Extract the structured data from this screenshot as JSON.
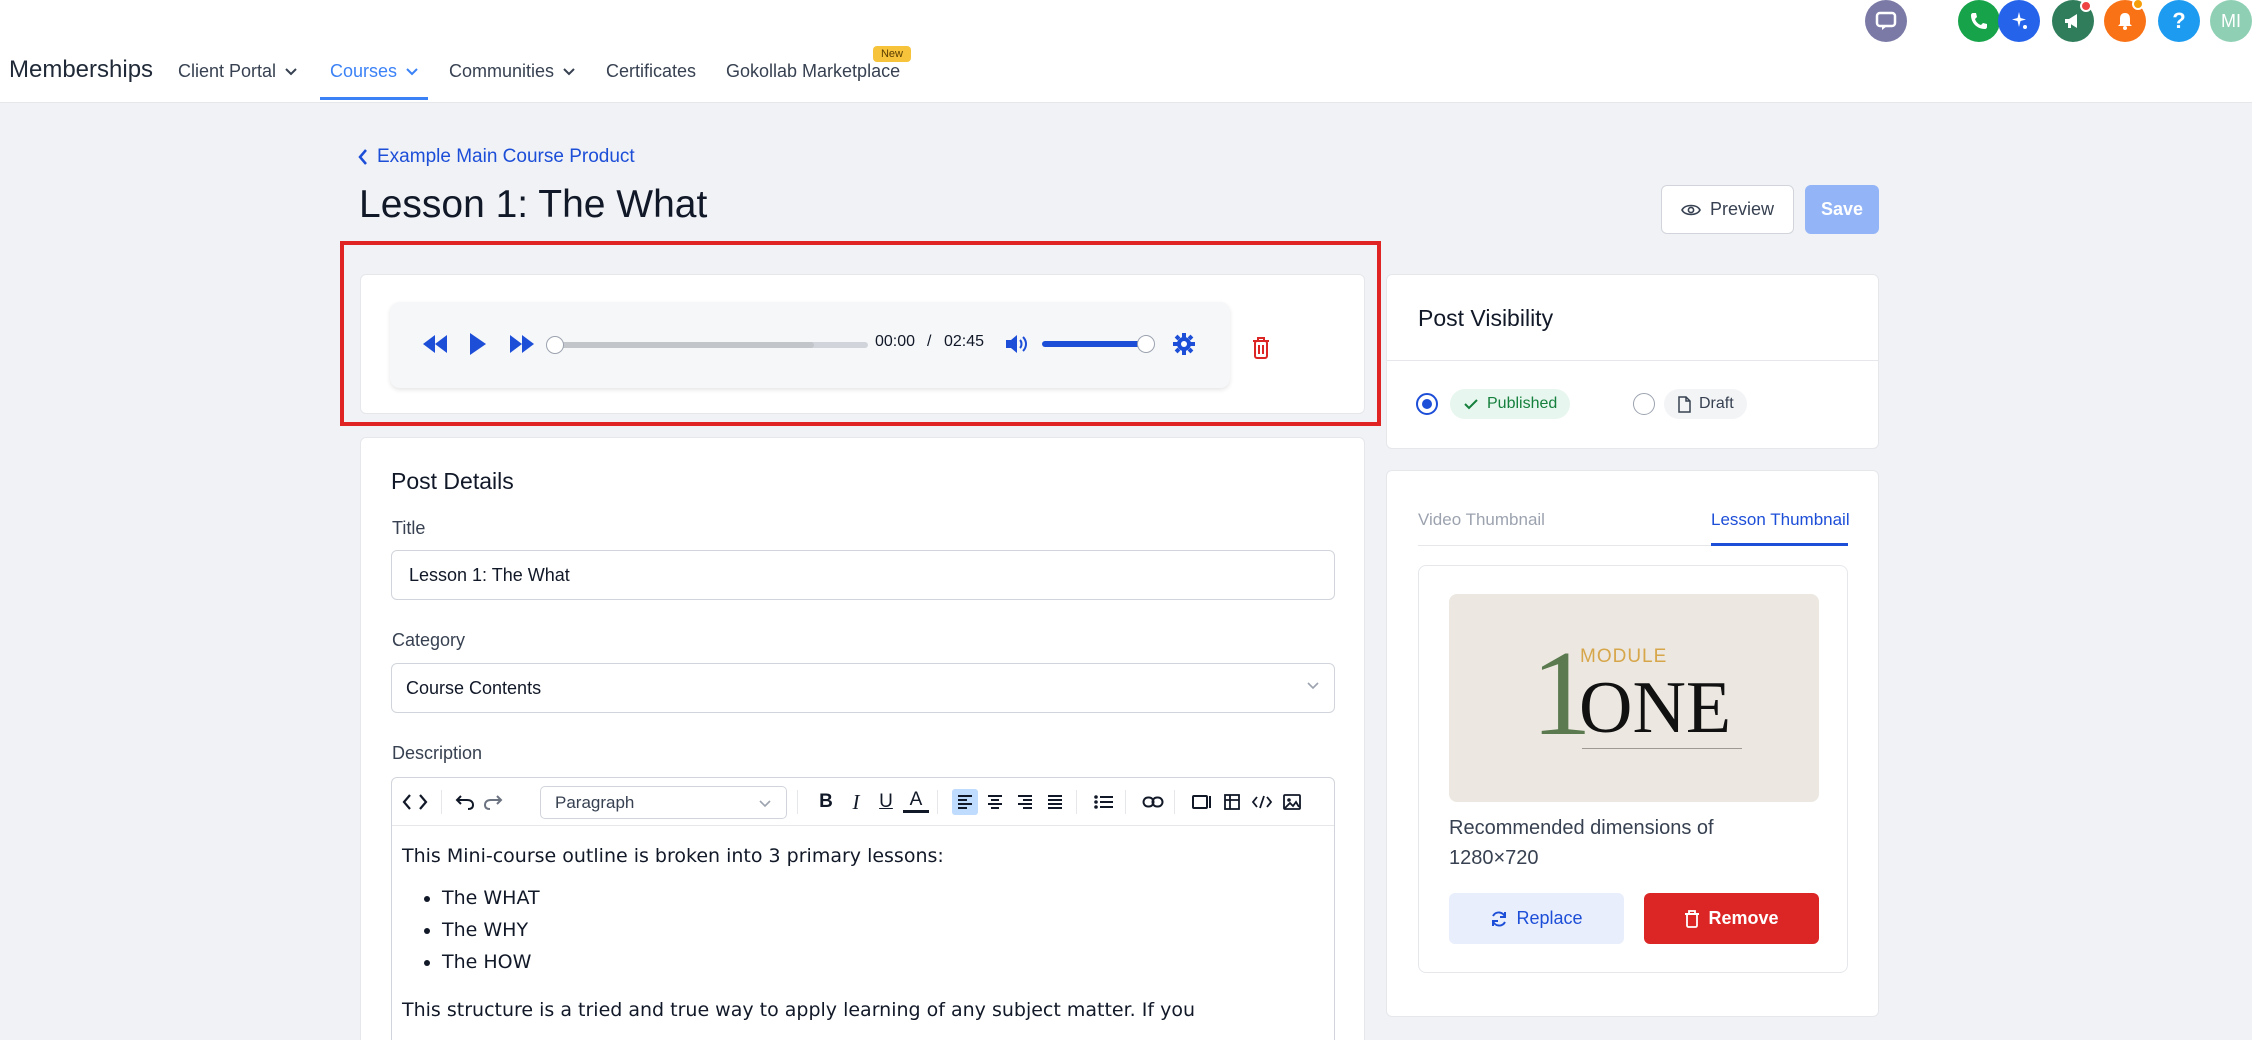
{
  "nav": {
    "brand": "Memberships",
    "items": [
      {
        "label": "Client Portal"
      },
      {
        "label": "Courses"
      },
      {
        "label": "Communities"
      },
      {
        "label": "Certificates"
      },
      {
        "label": "Gokollab Marketplace"
      }
    ],
    "new_badge": "New",
    "top_icons": [
      "chat-icon",
      "phone-icon",
      "magic-icon",
      "megaphone-icon",
      "bell-icon",
      "help-icon",
      "user-avatar"
    ],
    "avatar_initials": "MI"
  },
  "header": {
    "back_label": "Example Main Course Product",
    "title": "Lesson 1: The What",
    "preview_label": "Preview",
    "save_label": "Save"
  },
  "audio": {
    "current_time": "00:00",
    "separator": "/",
    "duration": "02:45",
    "progress": 0,
    "buffered": 0.83,
    "volume": 1.0
  },
  "details": {
    "heading": "Post Details",
    "title_label": "Title",
    "title_value": "Lesson 1: The What",
    "category_label": "Category",
    "category_value": "Course Contents",
    "description_label": "Description",
    "block_format": "Paragraph",
    "body_intro": "This Mini-course outline is broken into 3 primary lessons:",
    "body_list": [
      "The WHAT",
      "The WHY",
      "The HOW"
    ],
    "body_outro": "This structure is a tried and true way to apply learning of any subject matter. If you"
  },
  "visibility": {
    "heading": "Post Visibility",
    "published_label": "Published",
    "draft_label": "Draft",
    "selected": "Published"
  },
  "thumbnail": {
    "tab_video": "Video Thumbnail",
    "tab_lesson": "Lesson Thumbnail",
    "image_numeral": "1",
    "image_small": "MODULE",
    "image_big": "ONE",
    "recommended_line1": "Recommended dimensions of",
    "recommended_line2": "1280×720",
    "replace_label": "Replace",
    "remove_label": "Remove"
  },
  "colors": {
    "accent": "#1d4ed8",
    "highlight": "#e02424",
    "published_bg": "#e7f6ee",
    "published_text": "#15803d"
  }
}
